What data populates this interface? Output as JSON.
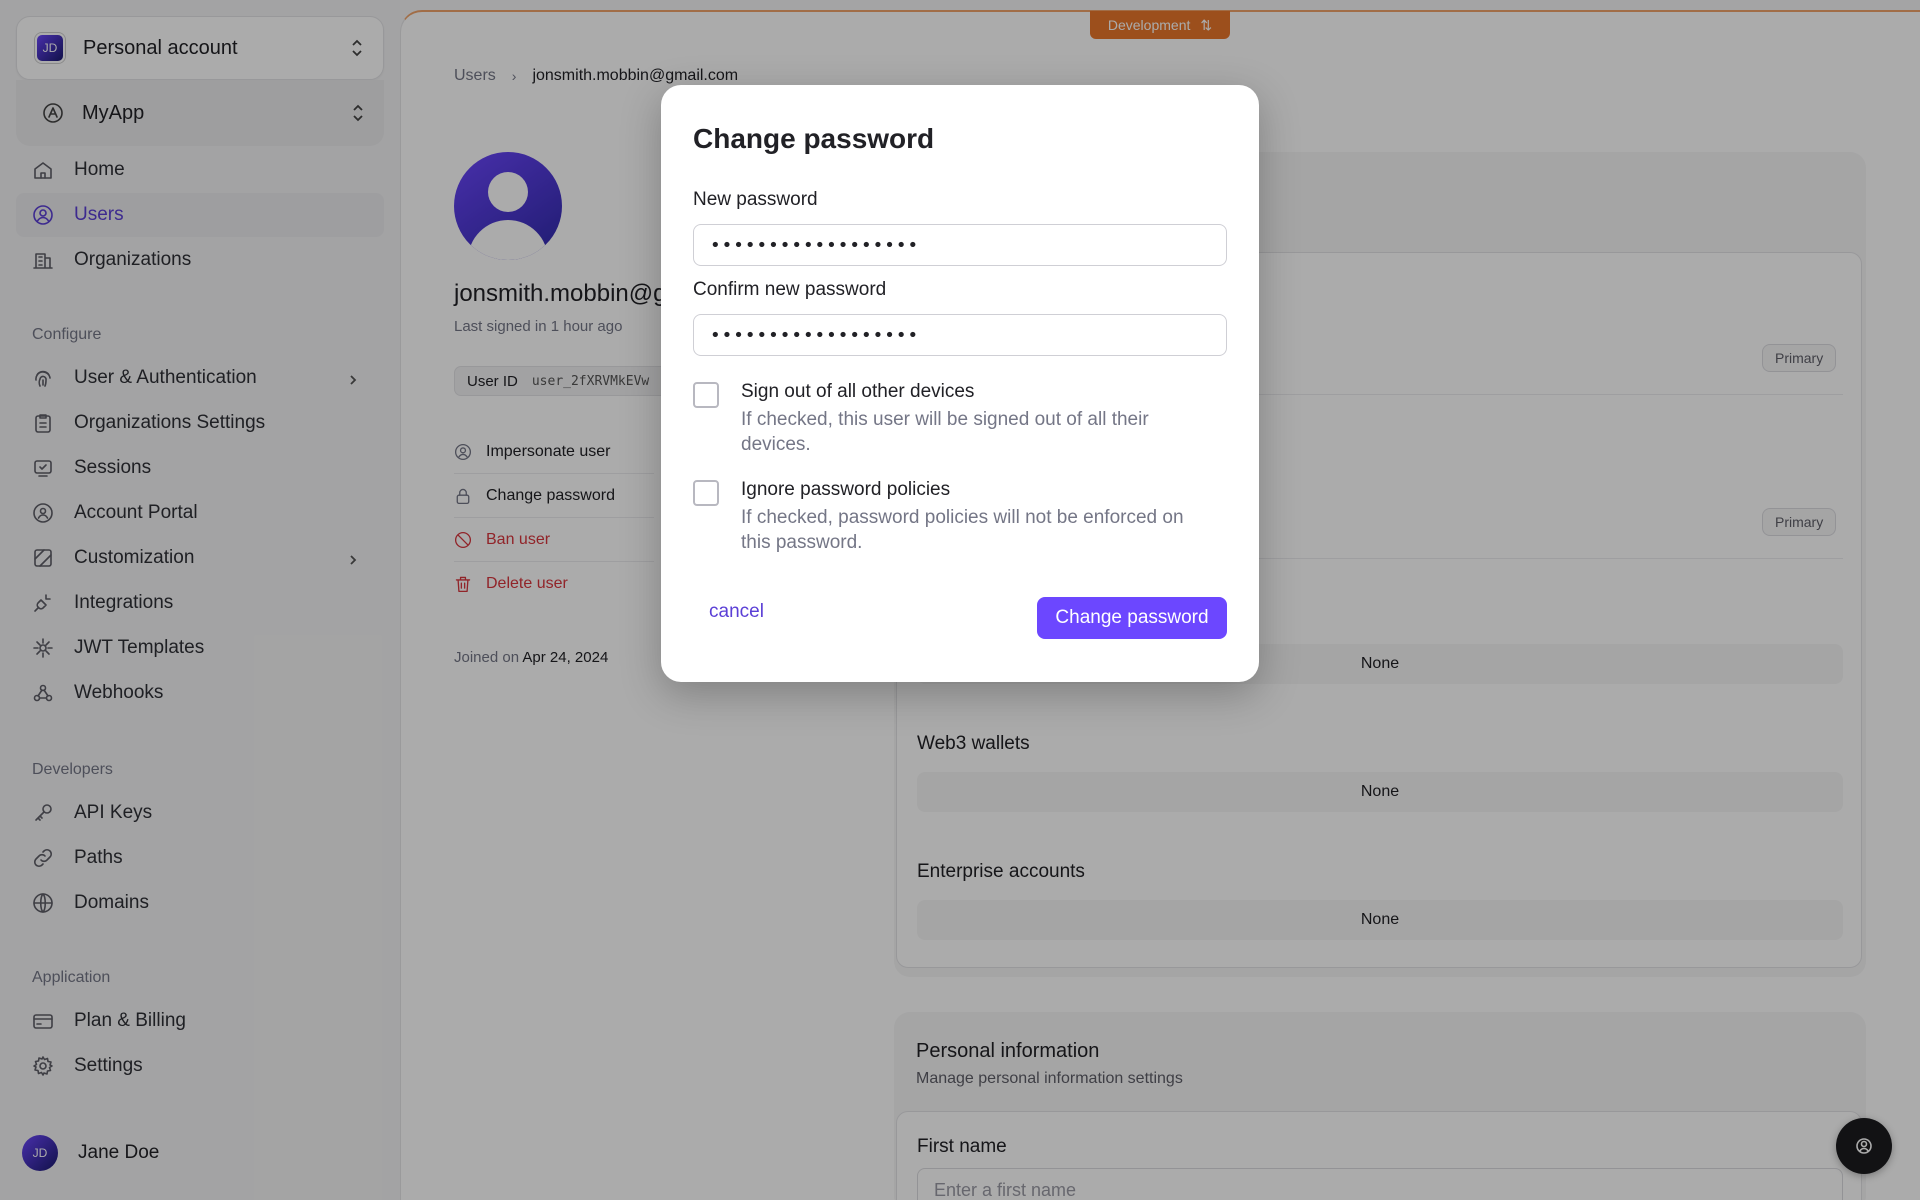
{
  "sidebar": {
    "account_switcher": {
      "initials": "JD",
      "label": "Personal account"
    },
    "app_switcher": {
      "label": "MyApp"
    },
    "nav": [
      {
        "label": "Home"
      },
      {
        "label": "Users"
      },
      {
        "label": "Organizations"
      }
    ],
    "configure_heading": "Configure",
    "configure": [
      {
        "label": "User & Authentication"
      },
      {
        "label": "Organizations Settings"
      },
      {
        "label": "Sessions"
      },
      {
        "label": "Account Portal"
      },
      {
        "label": "Customization"
      },
      {
        "label": "Integrations"
      },
      {
        "label": "JWT Templates"
      },
      {
        "label": "Webhooks"
      }
    ],
    "developers_heading": "Developers",
    "developers": [
      {
        "label": "API Keys"
      },
      {
        "label": "Paths"
      },
      {
        "label": "Domains"
      }
    ],
    "application_heading": "Application",
    "application": [
      {
        "label": "Plan & Billing"
      },
      {
        "label": "Settings"
      }
    ],
    "user": {
      "initials": "JD",
      "name": "Jane Doe"
    }
  },
  "main": {
    "env_badge": "Development",
    "breadcrumb": {
      "root": "Users",
      "current": "jonsmith.mobbin@gmail.com"
    },
    "profile": {
      "email": "jonsmith.mobbin@g",
      "last_signed": "Last signed in 1 hour ago",
      "user_id_label": "User ID",
      "user_id_value": "user_2fXRVMkEVw"
    },
    "actions": [
      {
        "label": "Impersonate user"
      },
      {
        "label": "Change password"
      },
      {
        "label": "Ban user"
      },
      {
        "label": "Delete user"
      }
    ],
    "joined_prefix": "Joined on",
    "joined_date": "Apr 24, 2024",
    "primary_badge": "Primary",
    "none_text": "None",
    "web3_title": "Web3 wallets",
    "enterprise_title": "Enterprise accounts",
    "personal_info": {
      "title": "Personal information",
      "subtitle": "Manage personal information settings",
      "first_name_label": "First name",
      "first_name_placeholder": "Enter a first name"
    }
  },
  "modal": {
    "title": "Change password",
    "new_password_label": "New password",
    "new_password_value": "••••••••••••••••••",
    "confirm_label": "Confirm new password",
    "confirm_value": "••••••••••••••••••",
    "option_signout": {
      "title": "Sign out of all other devices",
      "desc": "If checked, this user will be signed out of all their devices."
    },
    "option_ignore": {
      "title": "Ignore password policies",
      "desc": "If checked, password policies will not be enforced on this password."
    },
    "cancel_label": "cancel",
    "submit_label": "Change password"
  },
  "colors": {
    "accent": "#6c47ff",
    "danger": "#d9363e",
    "env_badge": "#e9772a"
  }
}
